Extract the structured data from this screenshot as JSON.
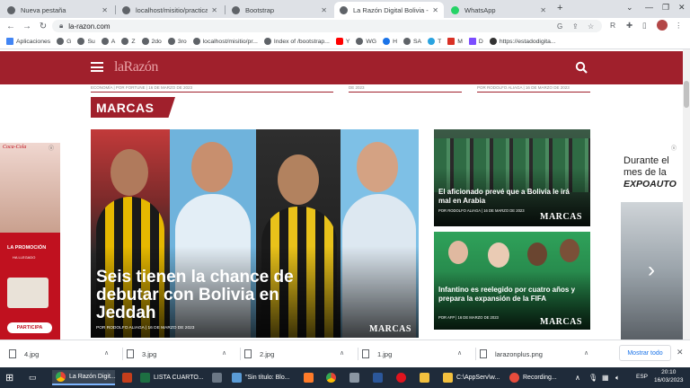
{
  "browser": {
    "tabs": [
      {
        "title": "Nueva pestaña",
        "active": false
      },
      {
        "title": "localhost/misitio/practica1/n",
        "active": false
      },
      {
        "title": "Bootstrap",
        "active": false
      },
      {
        "title": "La Razón Digital Bolivia - La",
        "active": true
      },
      {
        "title": "WhatsApp",
        "active": false
      }
    ],
    "new_tab": "+",
    "url": "la-razon.com",
    "bookmarks": [
      "Aplicaciones",
      "G",
      "Su",
      "A",
      "Z",
      "2do",
      "3ro",
      "localhost/misitio/pr...",
      "Index of /bootstrap...",
      "Y",
      "WG",
      "H",
      "SA",
      "T",
      "M",
      "D",
      "https://estadodigita..."
    ]
  },
  "site": {
    "logo": "laRazón",
    "section_title": "MARCAS",
    "prev_bylines": [
      "ECONOMÍA | POR FORTUNE | 16 DE MARZO DE 2023",
      "DE 2023",
      "POR RODOLFO ALIAGA | 16 DE MARZO DE 2023"
    ],
    "main_article": {
      "headline": "Seis tienen la chance de debutar con Bolivia en Jeddah",
      "byline": "POR RODOLFO ALIAGA | 16 DE MARZO DE 2023",
      "tag": "MARCAS"
    },
    "side_articles": [
      {
        "headline": "El aficionado prevé que a Bolivia le irá mal en Arabia",
        "byline": "POR RODOLFO ALIAGA | 16 DE MARZO DE 2023",
        "tag": "MARCAS"
      },
      {
        "headline": "Infantino es reelegido por cuatro años y prepara la expansión de la FIFA",
        "byline": "POR AFP | 16 DE MARZO DE 2023",
        "tag": "MARCAS"
      }
    ],
    "ad_left": {
      "brand": "Coca-Cola",
      "promo": "LA PROMOCIÓN",
      "sub": "HA LLEGADO",
      "cta": "PARTICIPA"
    },
    "ad_right": {
      "line1": "Durante el",
      "line2": "mes de la",
      "brand": "EXPOAUTO"
    }
  },
  "downloads": {
    "items": [
      "4.jpg",
      "3.jpg",
      "2.jpg",
      "1.jpg",
      "larazonplus.png"
    ],
    "show_all": "Mostrar todo"
  },
  "taskbar": {
    "items": [
      "La Razón Digit...",
      "LISTA CUARTO...",
      "\"Sin título: Blo...",
      "C:\\AppServ\\w...",
      "Recording..."
    ],
    "lang": "ESP",
    "time": "20:10",
    "date": "16/03/2023"
  }
}
